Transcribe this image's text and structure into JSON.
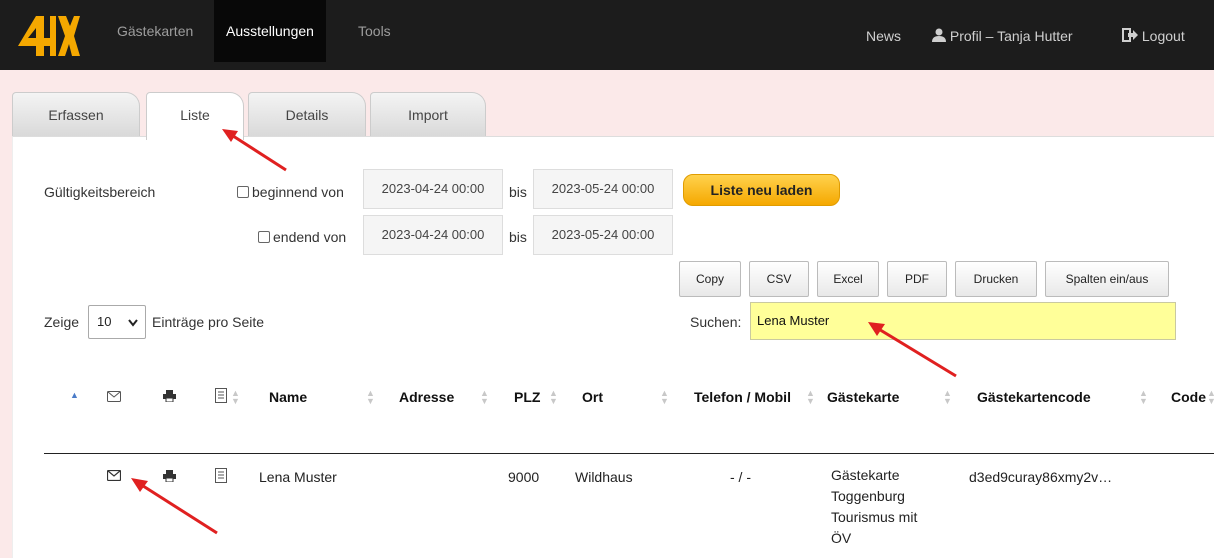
{
  "navbar": {
    "logo_text": "4IX",
    "items": [
      {
        "label": "Gästekarten"
      },
      {
        "label": "Ausstellungen"
      },
      {
        "label": "Tools"
      }
    ],
    "news": "News",
    "profile": "Profil – Tanja Hutter",
    "logout": "Logout",
    "profile_icon": "user-icon",
    "logout_icon": "logout-icon"
  },
  "tabs": [
    "Erfassen",
    "Liste",
    "Details",
    "Import"
  ],
  "filter": {
    "label": "Gültigkeitsbereich",
    "begin_label": "beginnend von",
    "end_label": "endend von",
    "bis": "bis",
    "begin_from": "2023-04-24 00:00",
    "begin_to": "2023-05-24 00:00",
    "end_from": "2023-04-24 00:00",
    "end_to": "2023-05-24 00:00",
    "reload_button": "Liste neu laden",
    "begin_checked": false,
    "end_checked": false
  },
  "toolbar": [
    "Copy",
    "CSV",
    "Excel",
    "PDF",
    "Drucken",
    "Spalten ein/aus"
  ],
  "paging": {
    "show_label": "Zeige",
    "page_size": "10",
    "entries_label": "Einträge pro Seite"
  },
  "search": {
    "label": "Suchen:",
    "value": "Lena Muster"
  },
  "table": {
    "columns": [
      "Name",
      "Adresse",
      "PLZ",
      "Ort",
      "Telefon / Mobil",
      "Gästekarte",
      "Gästekartencode",
      "Code"
    ],
    "rows": [
      {
        "name": "Lena Muster",
        "adresse": "",
        "plz": "9000",
        "ort": "Wildhaus",
        "telefon": "- / -",
        "gaestekarte": [
          "Gästekarte",
          "Toggenburg",
          "Tourismus mit",
          "ÖV"
        ],
        "code": "d3ed9curay86xmy2v…"
      }
    ]
  },
  "colors": {
    "navbar": "#1c1c1c",
    "accent": "#f5a800",
    "search_bg": "#ffff99",
    "arrow": "#e02020",
    "page_bg": "#fbe9e9"
  }
}
